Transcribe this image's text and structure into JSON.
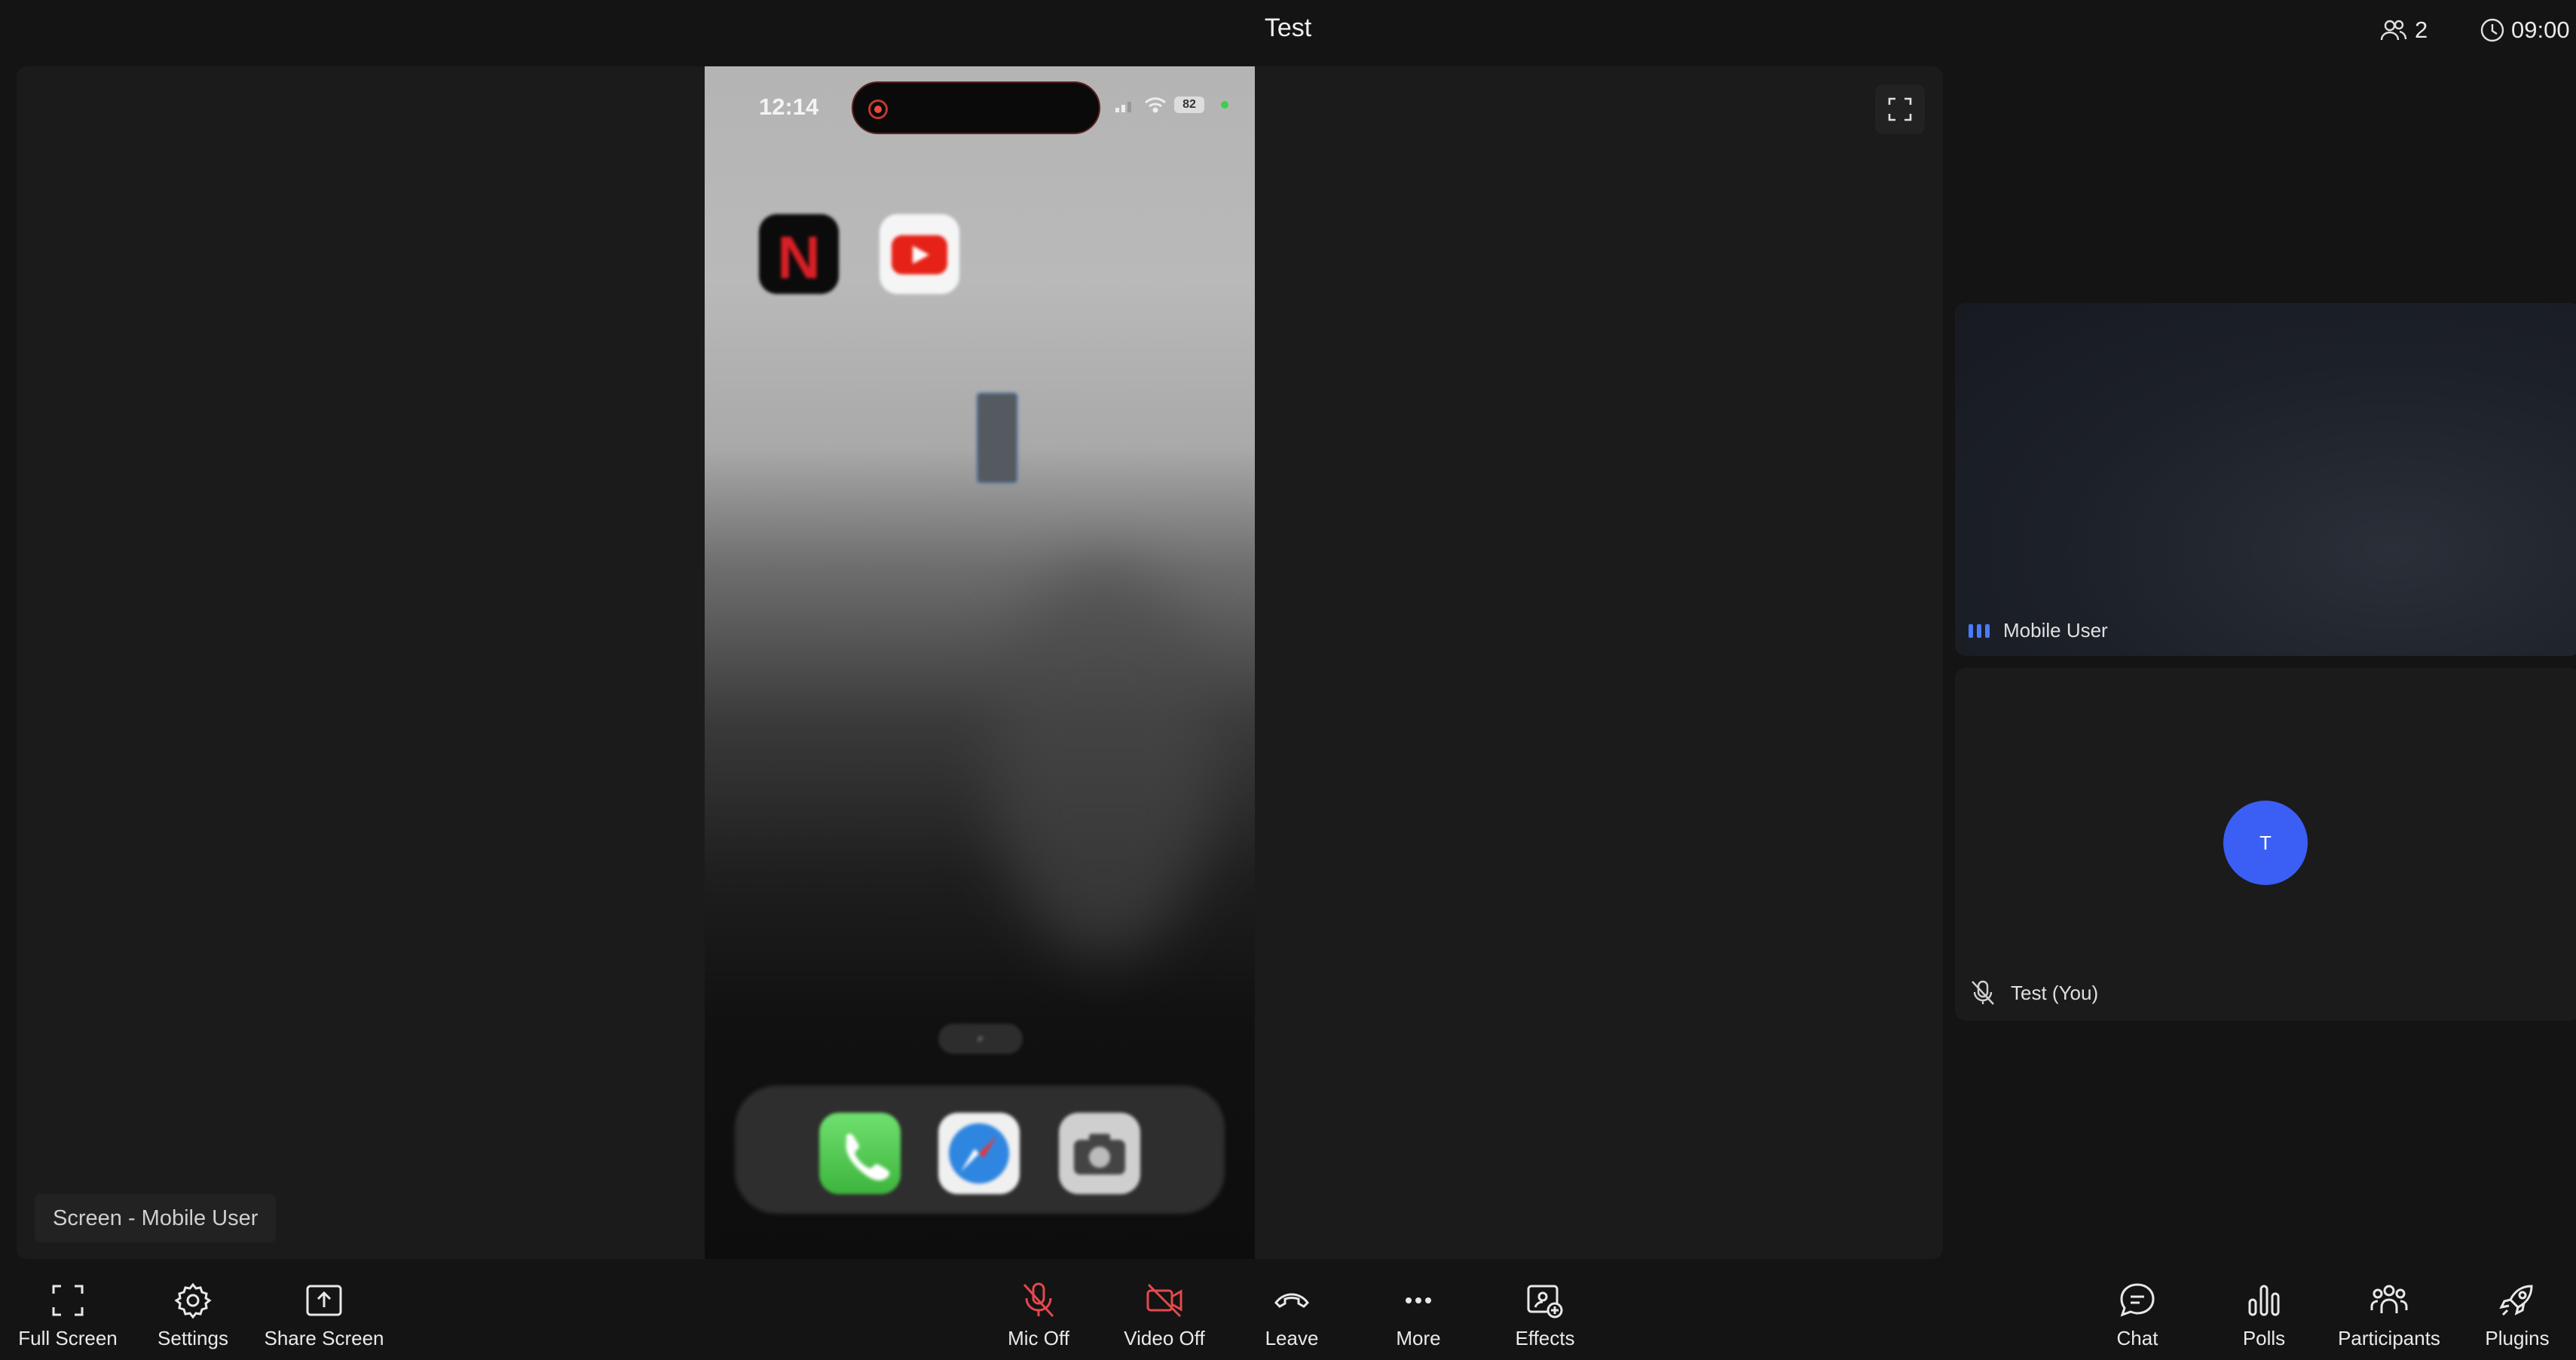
{
  "header": {
    "title": "Test",
    "participant_count": "2",
    "timer": "09:00"
  },
  "stage": {
    "label": "Screen - Mobile User",
    "shared_phone": {
      "status_time": "12:14",
      "battery": "82",
      "apps": [
        {
          "icon": "netflix-icon"
        },
        {
          "icon": "youtube-icon"
        }
      ],
      "dock": [
        "phone-icon",
        "safari-icon",
        "camera-icon"
      ]
    }
  },
  "participants": [
    {
      "name": "Mobile User",
      "state": "speaking"
    },
    {
      "name": "Test (You)",
      "initial": "T",
      "state": "muted",
      "avatar_color": "#3b5ef5"
    }
  ],
  "toolbar": {
    "left": [
      {
        "label": "Full Screen",
        "icon": "fullscreen-icon"
      },
      {
        "label": "Settings",
        "icon": "gear-icon"
      },
      {
        "label": "Share Screen",
        "icon": "share-screen-icon"
      }
    ],
    "center": [
      {
        "label": "Mic Off",
        "icon": "mic-off-icon",
        "color": "#e5484d"
      },
      {
        "label": "Video Off",
        "icon": "video-off-icon",
        "color": "#e5484d"
      },
      {
        "label": "Leave",
        "icon": "leave-icon"
      },
      {
        "label": "More",
        "icon": "more-icon"
      },
      {
        "label": "Effects",
        "icon": "effects-icon"
      }
    ],
    "right": [
      {
        "label": "Chat",
        "icon": "chat-icon"
      },
      {
        "label": "Polls",
        "icon": "polls-icon"
      },
      {
        "label": "Participants",
        "icon": "participants-icon"
      },
      {
        "label": "Plugins",
        "icon": "rocket-icon"
      }
    ]
  }
}
